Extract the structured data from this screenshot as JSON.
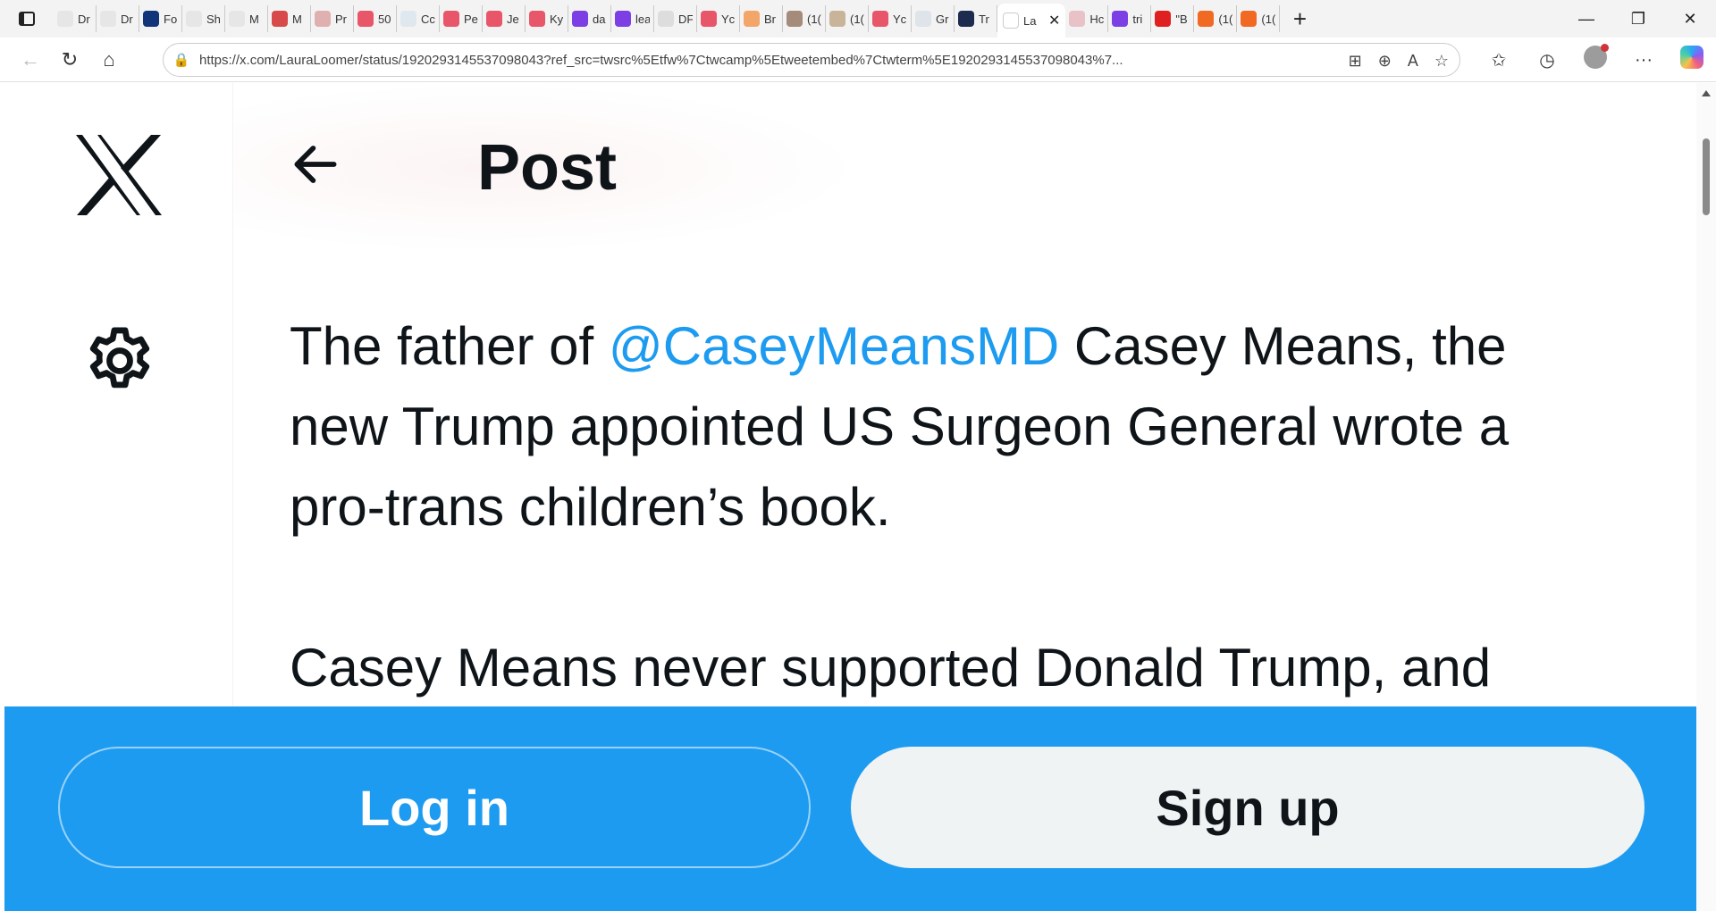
{
  "browser": {
    "tabs": [
      {
        "label": "Dr",
        "color": "#e6e6e6"
      },
      {
        "label": "Dr",
        "color": "#e6e6e6"
      },
      {
        "label": "Fo",
        "color": "#12357a"
      },
      {
        "label": "Sh",
        "color": "#e6e6e6"
      },
      {
        "label": "M",
        "color": "#e6e6e6"
      },
      {
        "label": "M",
        "color": "#d84a4a"
      },
      {
        "label": "Pr",
        "color": "#e0b0b0"
      },
      {
        "label": "50",
        "color": "#e8566a"
      },
      {
        "label": "Cc",
        "color": "#dfe8ef"
      },
      {
        "label": "Pe",
        "color": "#e8566a"
      },
      {
        "label": "Je",
        "color": "#e8566a"
      },
      {
        "label": "Ky",
        "color": "#e8566a"
      },
      {
        "label": "da",
        "color": "#7b3fe4"
      },
      {
        "label": "lea",
        "color": "#7b3fe4"
      },
      {
        "label": "DF",
        "color": "#dddddd"
      },
      {
        "label": "Yc",
        "color": "#e8566a"
      },
      {
        "label": "Br",
        "color": "#f2a66a"
      },
      {
        "label": "(1(",
        "color": "#a58b7a"
      },
      {
        "label": "(1(",
        "color": "#c9b49a"
      },
      {
        "label": "Yc",
        "color": "#e8566a"
      },
      {
        "label": "Gr",
        "color": "#dfe3ea"
      },
      {
        "label": "Tr",
        "color": "#1d2b4f"
      }
    ],
    "active_tab": {
      "label": "La",
      "color": "#ffffff"
    },
    "tabs_after": [
      {
        "label": "Hc",
        "color": "#e9c2c8"
      },
      {
        "label": "tri",
        "color": "#7b3fe4"
      },
      {
        "label": "\"B",
        "color": "#e02020"
      },
      {
        "label": "(1(",
        "color": "#f06a24"
      },
      {
        "label": "(1(",
        "color": "#f06a24"
      }
    ],
    "url": "https://x.com/LauraLoomer/status/1920293145537098043?ref_src=twsrc%5Etfw%7Ctwcamp%5Etweetembed%7Ctwterm%5E1920293145537098043%7..."
  },
  "page": {
    "header_title": "Post",
    "tweet": {
      "line1_a": "The father of ",
      "mention": "@CaseyMeansMD",
      "line1_b": " Casey Means, the",
      "line2": "new Trump appointed US Surgeon General wrote a",
      "line3": "pro-trans children’s  book.",
      "line4": "Casey Means never supported Donald Trump, and"
    }
  },
  "auth": {
    "login_label": "Log in",
    "signup_label": "Sign up"
  },
  "colors": {
    "accent": "#1d9bf0",
    "text": "#0f1419",
    "signup_bg": "#eff3f4"
  }
}
